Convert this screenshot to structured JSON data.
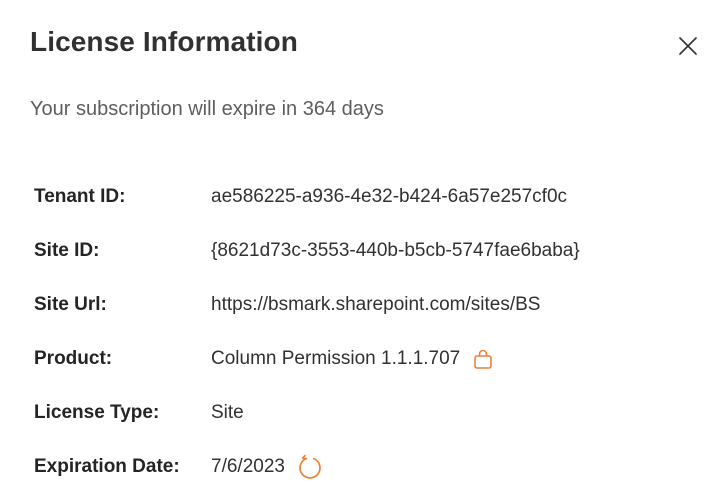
{
  "dialog": {
    "title": "License Information",
    "subtitle": "Your subscription will expire in 364 days",
    "close_icon": "close-icon"
  },
  "fields": {
    "tenant_id": {
      "label": "Tenant ID:",
      "value": "ae586225-a936-4e32-b424-6a57e257cf0c"
    },
    "site_id": {
      "label": "Site ID:",
      "value": "{8621d73c-3553-440b-b5cb-5747fae6baba}"
    },
    "site_url": {
      "label": "Site Url:",
      "value": "https://bsmark.sharepoint.com/sites/BS"
    },
    "product": {
      "label": "Product:",
      "value": "Column Permission 1.1.1.707",
      "icon": "shopping-bag-icon"
    },
    "license_type": {
      "label": "License Type:",
      "value": "Site"
    },
    "expiration_date": {
      "label": "Expiration Date:",
      "value": "7/6/2023",
      "icon": "refresh-icon"
    }
  },
  "colors": {
    "accent": "#e8833a",
    "title_text": "#323130",
    "subtitle_text": "#605e5c"
  }
}
